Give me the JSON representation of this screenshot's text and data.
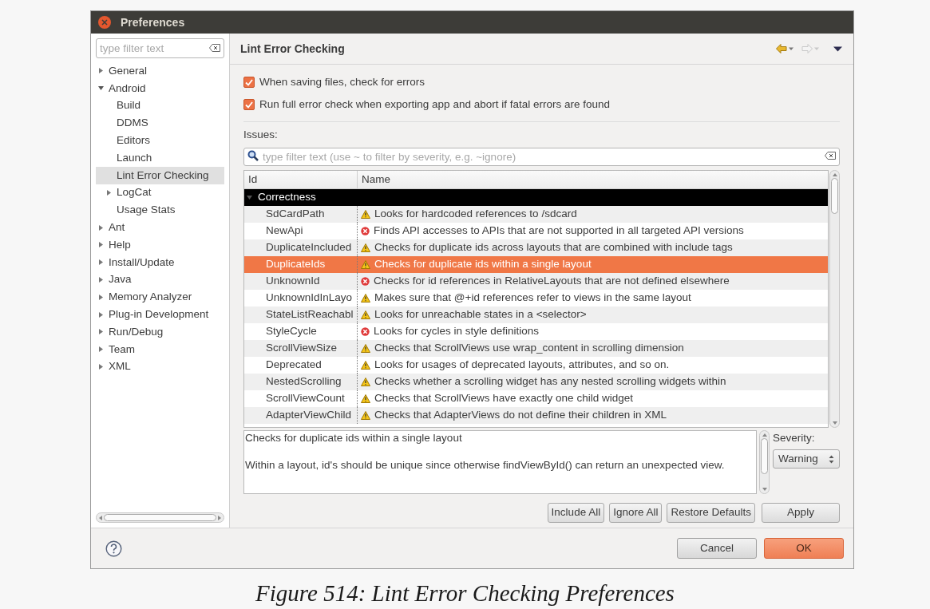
{
  "window": {
    "title": "Preferences"
  },
  "filter": {
    "placeholder": "type filter text"
  },
  "tree": [
    {
      "label": "General",
      "expanded": false,
      "selected": false
    },
    {
      "label": "Android",
      "expanded": true,
      "selected": false,
      "children": [
        {
          "label": "Build",
          "selected": false
        },
        {
          "label": "DDMS",
          "selected": false
        },
        {
          "label": "Editors",
          "selected": false
        },
        {
          "label": "Launch",
          "selected": false
        },
        {
          "label": "Lint Error Checking",
          "selected": true
        },
        {
          "label": "LogCat",
          "expanded": false,
          "selected": false
        },
        {
          "label": "Usage Stats",
          "selected": false
        }
      ]
    },
    {
      "label": "Ant",
      "expanded": false,
      "selected": false
    },
    {
      "label": "Help",
      "expanded": false,
      "selected": false
    },
    {
      "label": "Install/Update",
      "expanded": false,
      "selected": false
    },
    {
      "label": "Java",
      "expanded": false,
      "selected": false
    },
    {
      "label": "Memory Analyzer",
      "expanded": false,
      "selected": false
    },
    {
      "label": "Plug-in Development",
      "expanded": false,
      "selected": false
    },
    {
      "label": "Run/Debug",
      "expanded": false,
      "selected": false
    },
    {
      "label": "Team",
      "expanded": false,
      "selected": false
    },
    {
      "label": "XML",
      "expanded": false,
      "selected": false
    }
  ],
  "page": {
    "title": "Lint Error Checking",
    "nav": [
      {
        "kind": "back",
        "disabled": false
      },
      {
        "kind": "forward",
        "disabled": true
      },
      {
        "kind": "menu",
        "disabled": false
      }
    ]
  },
  "options": [
    {
      "label": "When saving files, check for errors",
      "checked": true
    },
    {
      "label": "Run full error check when exporting app and abort if fatal errors are found",
      "checked": true
    }
  ],
  "issues": {
    "label": "Issues:",
    "placeholder": "type filter text (use ~ to filter by severity, e.g. ~ignore)",
    "columns": [
      "Id",
      "Name"
    ],
    "categories": [
      {
        "label": "Correctness",
        "expanded": true,
        "rows": [
          {
            "id": "SdCardPath",
            "kind": "warning",
            "name": "Looks for hardcoded references to /sdcard",
            "selected": false
          },
          {
            "id": "NewApi",
            "kind": "error",
            "name": "Finds API accesses to APIs that are not supported in all targeted API versions",
            "selected": false
          },
          {
            "id": "DuplicateIncluded",
            "kind": "warning",
            "name": "Checks for duplicate ids across layouts that are combined with include tags",
            "selected": false
          },
          {
            "id": "DuplicateIds",
            "kind": "warning",
            "name": "Checks for duplicate ids within a single layout",
            "selected": true
          },
          {
            "id": "UnknownId",
            "kind": "error",
            "name": "Checks for id references in RelativeLayouts that are not defined elsewhere",
            "selected": false
          },
          {
            "id": "UnknownIdInLayo",
            "kind": "warning",
            "name": "Makes sure that @+id references refer to views in the same layout",
            "selected": false
          },
          {
            "id": "StateListReachabl",
            "kind": "warning",
            "name": "Looks for unreachable states in a <selector>",
            "selected": false
          },
          {
            "id": "StyleCycle",
            "kind": "error",
            "name": "Looks for cycles in style definitions",
            "selected": false
          },
          {
            "id": "ScrollViewSize",
            "kind": "warning",
            "name": "Checks that ScrollViews use wrap_content in scrolling dimension",
            "selected": false
          },
          {
            "id": "Deprecated",
            "kind": "warning",
            "name": "Looks for usages of deprecated layouts, attributes, and so on.",
            "selected": false
          },
          {
            "id": "NestedScrolling",
            "kind": "warning",
            "name": "Checks whether a scrolling widget has any nested scrolling widgets within",
            "selected": false
          },
          {
            "id": "ScrollViewCount",
            "kind": "warning",
            "name": "Checks that ScrollViews have exactly one child widget",
            "selected": false
          },
          {
            "id": "AdapterViewChild",
            "kind": "warning",
            "name": "Checks that AdapterViews do not define their children in XML",
            "selected": false
          }
        ]
      }
    ]
  },
  "description": [
    "Checks for duplicate ids within a single layout",
    "Within a layout, id's should be unique since otherwise findViewById() can return an unexpected view."
  ],
  "severity": {
    "label": "Severity:",
    "value": "Warning"
  },
  "actions": [
    "Include All",
    "Ignore All",
    "Restore Defaults",
    "Apply"
  ],
  "buttons": [
    {
      "label": "Cancel",
      "default": false
    },
    {
      "label": "OK",
      "default": true
    }
  ],
  "caption": "Figure 514: Lint Error Checking Preferences"
}
